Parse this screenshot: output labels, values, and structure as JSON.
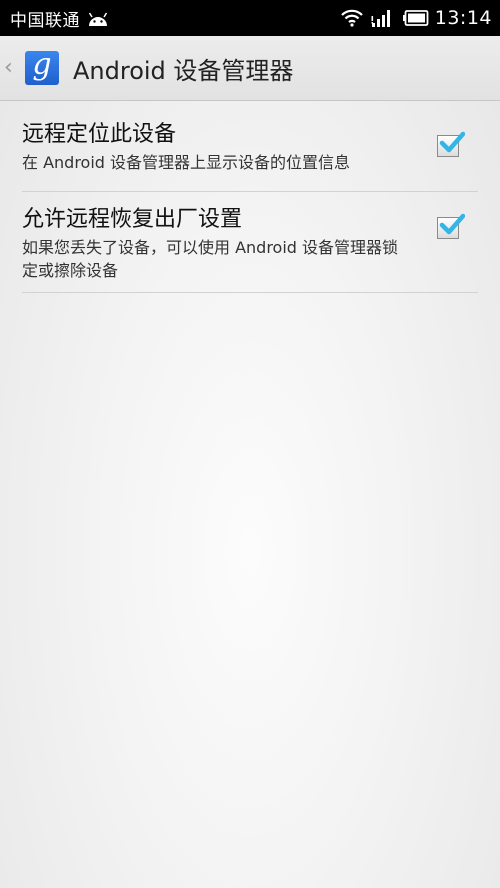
{
  "status_bar": {
    "carrier": "中国联通",
    "time": "13:14"
  },
  "action_bar": {
    "up_glyph": "‹",
    "app_icon_letter": "g",
    "title": "Android 设备管理器"
  },
  "settings": [
    {
      "title": "远程定位此设备",
      "summary": "在 Android 设备管理器上显示设备的位置信息",
      "checked": true
    },
    {
      "title": "允许远程恢复出厂设置",
      "summary": "如果您丢失了设备，可以使用 Android 设备管理器锁定或擦除设备",
      "checked": true
    }
  ],
  "colors": {
    "checkmark": "#33b5e5",
    "status_bar_bg": "#000000",
    "app_icon_bg": "#2a6fe0"
  },
  "icons": [
    "android-icon",
    "wifi-icon",
    "signal-icon",
    "battery-icon",
    "up-icon",
    "app-icon",
    "checkmark-icon"
  ]
}
